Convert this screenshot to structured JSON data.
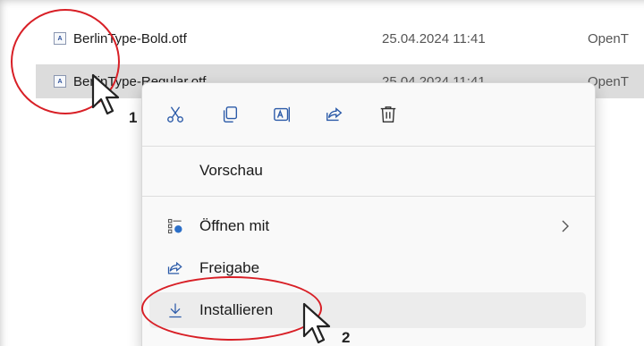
{
  "files": [
    {
      "name": "BerlinType-Bold.otf",
      "date": "25.04.2024 11:41",
      "type": "OpenT",
      "selected": false
    },
    {
      "name": "BerlinType-Regular.otf",
      "date": "25.04.2024 11:41",
      "type": "OpenT",
      "selected": true
    }
  ],
  "context_menu": {
    "quick_actions": [
      "cut-icon",
      "copy-icon",
      "rename-icon",
      "share-icon",
      "delete-icon"
    ],
    "items": [
      {
        "label": "Vorschau",
        "icon": ""
      },
      {
        "label": "Öffnen mit",
        "icon": "open-with-icon",
        "submenu": true
      },
      {
        "label": "Freigabe",
        "icon": "share-icon"
      },
      {
        "label": "Installieren",
        "icon": "download-icon",
        "hover": true
      }
    ]
  },
  "annotations": {
    "step1": "1",
    "step2": "2",
    "accent_color": "#d81f26"
  }
}
